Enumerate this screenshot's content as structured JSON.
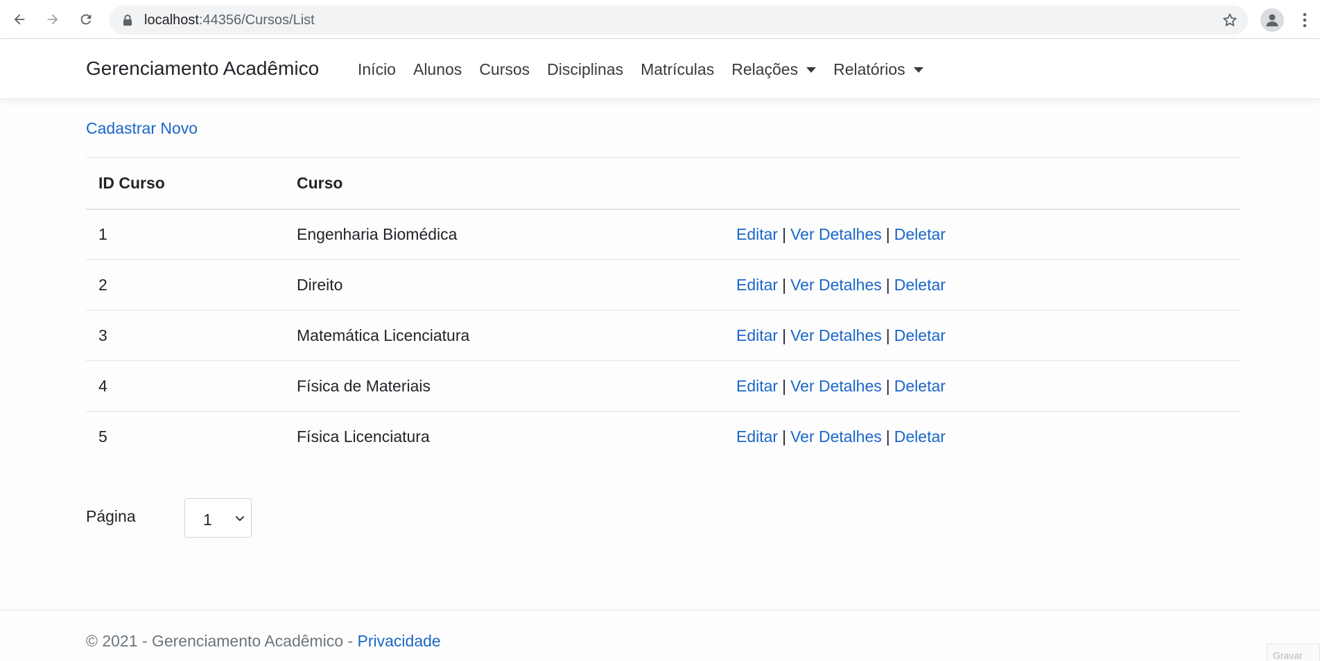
{
  "browser": {
    "url_host": "localhost",
    "url_path": ":44356/Cursos/List"
  },
  "navbar": {
    "brand": "Gerenciamento Acadêmico",
    "items": [
      {
        "label": "Início"
      },
      {
        "label": "Alunos"
      },
      {
        "label": "Cursos"
      },
      {
        "label": "Disciplinas"
      },
      {
        "label": "Matrículas"
      },
      {
        "label": "Relações"
      },
      {
        "label": "Relatórios"
      }
    ]
  },
  "main": {
    "new_link": "Cadastrar Novo",
    "table": {
      "headers": [
        "ID Curso",
        "Curso",
        ""
      ],
      "rows": [
        {
          "id": "1",
          "name": "Engenharia Biomédica"
        },
        {
          "id": "2",
          "name": "Direito"
        },
        {
          "id": "3",
          "name": "Matemática Licenciatura"
        },
        {
          "id": "4",
          "name": "Física de Materiais"
        },
        {
          "id": "5",
          "name": "Física Licenciatura"
        }
      ],
      "actions": {
        "edit": "Editar",
        "details": "Ver Detalhes",
        "delete": "Deletar",
        "separator": "|"
      }
    },
    "pager": {
      "label": "Página",
      "selected": "1"
    }
  },
  "footer": {
    "text": "© 2021 - Gerenciamento Acadêmico - ",
    "privacy": "Privacidade"
  },
  "overlay": {
    "record_label": "Gravar"
  },
  "colors": {
    "link": "#1a66c9",
    "text": "#212529",
    "muted": "#6c757d"
  }
}
